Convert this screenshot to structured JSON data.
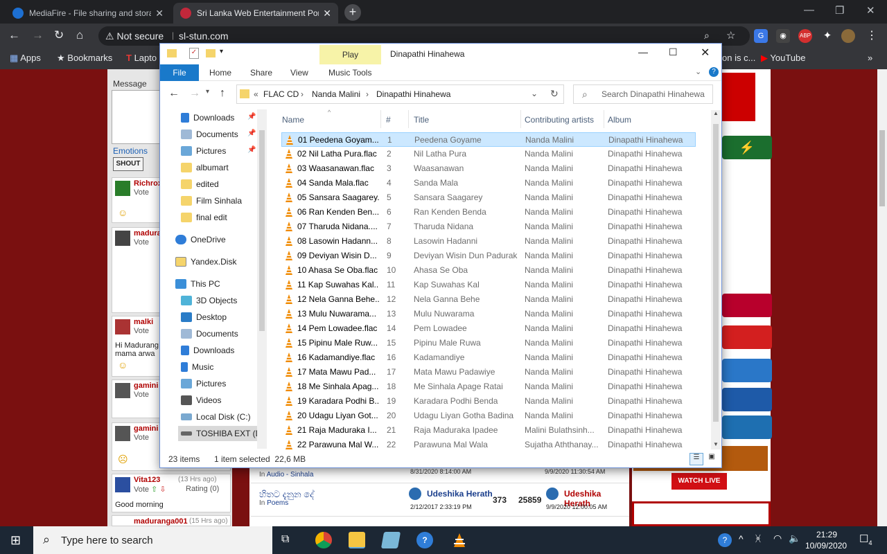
{
  "browser": {
    "tabs": [
      {
        "title": "MediaFire - File sharing and stora",
        "icon": "mediafire-icon",
        "active": false
      },
      {
        "title": "Sri Lanka Web Entertainment Por",
        "icon": "sl-stun-icon",
        "active": true
      }
    ],
    "new_tab": "+",
    "omnibox": {
      "security": "Not secure",
      "url": "sl-stun.com"
    },
    "extensions": [
      "G",
      "ABP"
    ],
    "bookmarks": [
      {
        "label": "Apps"
      },
      {
        "label": "Bookmarks"
      },
      {
        "label": "Lapto"
      },
      {
        "label": "on is c..."
      },
      {
        "label": "YouTube"
      }
    ]
  },
  "website": {
    "message_label": "Message",
    "emotions_label": "Emotions",
    "shout_button": "SHOUT",
    "shouts": [
      {
        "user": "Richrox",
        "vote": "Vote",
        "text": ""
      },
      {
        "user": "madura",
        "vote": "Vote",
        "text": ""
      },
      {
        "user": "malki",
        "vote": "Vote",
        "text": "Hi Madurang mama arwa"
      },
      {
        "user": "gamini",
        "vote": "Vote",
        "text": ""
      },
      {
        "user": "gamini",
        "vote": "Vote",
        "text": ""
      },
      {
        "user": "Vita123",
        "time": "(13 Hrs ago)",
        "vote": "Vote",
        "rating": "Rating",
        "rating_val": "(0)",
        "text": "Good morning"
      },
      {
        "user": "maduranga001",
        "time": "(15 Hrs ago)"
      }
    ],
    "posts": [
      {
        "category_prefix": "In",
        "category": "Audio - Sinhala",
        "date1": "8/31/2020 8:14:00 AM",
        "date2": "9/9/2020 11:30:54 AM"
      },
      {
        "title": "හිතට දැනුන දේ",
        "category_prefix": "In",
        "category": "Poems",
        "author": "Udeshika Herath",
        "date1": "2/12/2017 2:33:19 PM",
        "replies": "373",
        "views": "25859",
        "last_author": "Udeshika Herath",
        "date2": "9/9/2020 12:00:05 AM"
      }
    ],
    "watch_live": "WATCH LIVE"
  },
  "explorer": {
    "title": "Dinapathi Hinahewa",
    "contextual_tab": "Play",
    "ribbon_tabs": [
      "File",
      "Home",
      "Share",
      "View",
      "Music Tools"
    ],
    "address": {
      "prefix": "«",
      "parts": [
        "FLAC CD",
        "Nanda Malini",
        "Dinapathi Hinahewa"
      ]
    },
    "search_placeholder": "Search Dinapathi Hinahewa",
    "nav": [
      {
        "label": "Downloads",
        "icon": "download-icon",
        "pinned": true
      },
      {
        "label": "Documents",
        "icon": "documents-icon",
        "pinned": true
      },
      {
        "label": "Pictures",
        "icon": "pictures-icon",
        "pinned": true
      },
      {
        "label": "albumart",
        "icon": "folder-icon"
      },
      {
        "label": "edited",
        "icon": "folder-icon"
      },
      {
        "label": "Film Sinhala",
        "icon": "folder-icon"
      },
      {
        "label": "final edit",
        "icon": "folder-icon"
      },
      {
        "label": "OneDrive",
        "icon": "onedrive-icon"
      },
      {
        "label": "Yandex.Disk",
        "icon": "yandex-icon"
      },
      {
        "label": "This PC",
        "icon": "pc-icon"
      },
      {
        "label": "3D Objects",
        "icon": "3d-objects-icon"
      },
      {
        "label": "Desktop",
        "icon": "desktop-icon"
      },
      {
        "label": "Documents",
        "icon": "documents-icon"
      },
      {
        "label": "Downloads",
        "icon": "download-icon"
      },
      {
        "label": "Music",
        "icon": "music-icon"
      },
      {
        "label": "Pictures",
        "icon": "pictures-icon"
      },
      {
        "label": "Videos",
        "icon": "videos-icon"
      },
      {
        "label": "Local Disk (C:)",
        "icon": "drive-icon"
      },
      {
        "label": "TOSHIBA EXT (D:",
        "icon": "usb-drive-icon"
      }
    ],
    "columns": [
      "Name",
      "#",
      "Title",
      "Contributing artists",
      "Album"
    ],
    "files": [
      {
        "name": "01 Peedena Goyam...",
        "num": "1",
        "title": "Peedena Goyame",
        "artist": "Nanda Malini",
        "album": "Dinapathi Hinahewa",
        "selected": true
      },
      {
        "name": "02 Nil Latha Pura.flac",
        "num": "2",
        "title": "Nil Latha Pura",
        "artist": "Nanda Malini",
        "album": "Dinapathi Hinahewa"
      },
      {
        "name": "03 Waasanawan.flac",
        "num": "3",
        "title": "Waasanawan",
        "artist": "Nanda Malini",
        "album": "Dinapathi Hinahewa"
      },
      {
        "name": "04 Sanda Mala.flac",
        "num": "4",
        "title": "Sanda Mala",
        "artist": "Nanda Malini",
        "album": "Dinapathi Hinahewa"
      },
      {
        "name": "05 Sansara Saagarey...",
        "num": "5",
        "title": "Sansara Saagarey",
        "artist": "Nanda Malini",
        "album": "Dinapathi Hinahewa"
      },
      {
        "name": "06 Ran Kenden Ben...",
        "num": "6",
        "title": "Ran Kenden Benda",
        "artist": "Nanda Malini",
        "album": "Dinapathi Hinahewa"
      },
      {
        "name": "07 Tharuda Nidana....",
        "num": "7",
        "title": "Tharuda Nidana",
        "artist": "Nanda Malini",
        "album": "Dinapathi Hinahewa"
      },
      {
        "name": "08 Lasowin Hadann...",
        "num": "8",
        "title": "Lasowin Hadanni",
        "artist": "Nanda Malini",
        "album": "Dinapathi Hinahewa"
      },
      {
        "name": "09 Deviyan Wisin D...",
        "num": "9",
        "title": "Deviyan Wisin Dun Padurak",
        "artist": "Nanda Malini",
        "album": "Dinapathi Hinahewa"
      },
      {
        "name": "10 Ahasa Se Oba.flac",
        "num": "10",
        "title": "Ahasa Se Oba",
        "artist": "Nanda Malini",
        "album": "Dinapathi Hinahewa"
      },
      {
        "name": "11 Kap Suwahas Kal...",
        "num": "11",
        "title": "Kap Suwahas Kal",
        "artist": "Nanda Malini",
        "album": "Dinapathi Hinahewa"
      },
      {
        "name": "12 Nela Ganna Behe...",
        "num": "12",
        "title": "Nela Ganna Behe",
        "artist": "Nanda Malini",
        "album": "Dinapathi Hinahewa"
      },
      {
        "name": "13 Mulu Nuwarama...",
        "num": "13",
        "title": "Mulu Nuwarama",
        "artist": "Nanda Malini",
        "album": "Dinapathi Hinahewa"
      },
      {
        "name": "14 Pem Lowadee.flac",
        "num": "14",
        "title": "Pem Lowadee",
        "artist": "Nanda Malini",
        "album": "Dinapathi Hinahewa"
      },
      {
        "name": "15 Pipinu Male Ruw...",
        "num": "15",
        "title": "Pipinu Male Ruwa",
        "artist": "Nanda Malini",
        "album": "Dinapathi Hinahewa"
      },
      {
        "name": "16 Kadamandiye.flac",
        "num": "16",
        "title": "Kadamandiye",
        "artist": "Nanda Malini",
        "album": "Dinapathi Hinahewa"
      },
      {
        "name": "17 Mata Mawu Pad...",
        "num": "17",
        "title": "Mata Mawu Padawiye",
        "artist": "Nanda Malini",
        "album": "Dinapathi Hinahewa"
      },
      {
        "name": "18 Me Sinhala Apag...",
        "num": "18",
        "title": "Me Sinhala Apage Ratai",
        "artist": "Nanda Malini",
        "album": "Dinapathi Hinahewa"
      },
      {
        "name": "19 Karadara Podhi B...",
        "num": "19",
        "title": "Karadara Podhi Benda",
        "artist": "Nanda Malini",
        "album": "Dinapathi Hinahewa"
      },
      {
        "name": "20 Udagu Liyan Got...",
        "num": "20",
        "title": "Udagu Liyan Gotha Badina",
        "artist": "Nanda Malini",
        "album": "Dinapathi Hinahewa"
      },
      {
        "name": "21 Raja Maduraka I...",
        "num": "21",
        "title": "Raja Maduraka Ipadee",
        "artist": "Malini Bulathsinh...",
        "album": "Dinapathi Hinahewa"
      },
      {
        "name": "22 Parawuna Mal W...",
        "num": "22",
        "title": "Parawuna Mal Wala",
        "artist": "Sujatha Aththanay...",
        "album": "Dinapathi Hinahewa"
      }
    ],
    "status": {
      "count": "23 items",
      "selected": "1 item selected",
      "size": "22,6 MB"
    }
  },
  "taskbar": {
    "search_placeholder": "Type here to search",
    "time": "21:29",
    "date": "10/09/2020",
    "notifications": "4"
  },
  "colors": {
    "accent": "#1979ca",
    "selection": "#cce8ff",
    "chrome_dark": "#202124",
    "vlc_orange": "#f08a00"
  }
}
